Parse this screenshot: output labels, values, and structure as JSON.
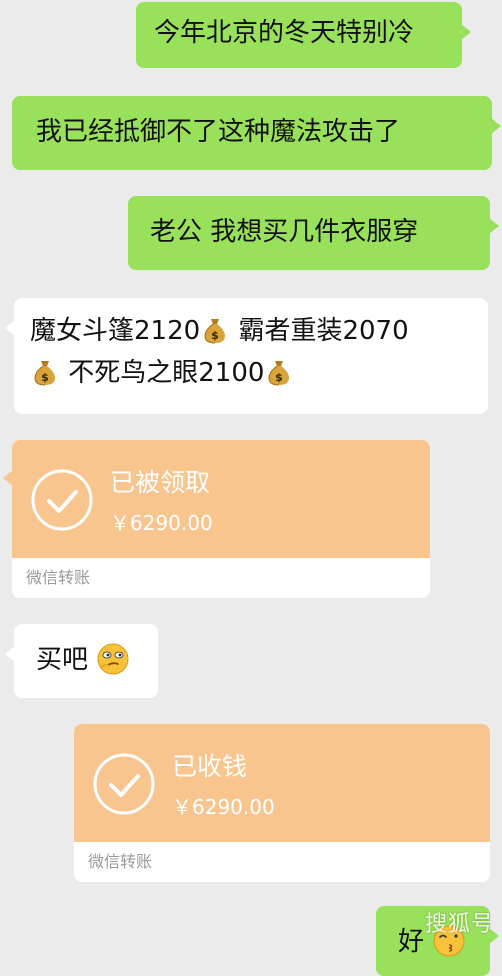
{
  "messages": [
    {
      "side": "right",
      "text": "今年北京的冬天特别冷"
    },
    {
      "side": "right",
      "text": "我已经抵御不了这种魔法攻击了"
    },
    {
      "side": "right",
      "text": "老公 我想买几件衣服穿"
    }
  ],
  "shopping": {
    "item1": "魔女斗篷2120",
    "item2": "霸者重装2070",
    "item3": "不死鸟之眼2100",
    "icon": "money-bag-icon"
  },
  "transfer_received": {
    "status": "已被领取",
    "amount": "￥6290.00",
    "footer": "微信转账",
    "color": "#f8c58f"
  },
  "reply": {
    "text": "买吧",
    "icon": "smirk-emoji-icon"
  },
  "transfer_collected": {
    "status": "已收钱",
    "amount": "￥6290.00",
    "footer": "微信转账",
    "color": "#f8c58f"
  },
  "final_message": {
    "text": "好",
    "icon": "kiss-emoji-icon"
  },
  "watermark": "搜狐号",
  "colors": {
    "background": "#ebebeb",
    "sent_bubble": "#99e15a",
    "received_bubble": "#ffffff"
  }
}
